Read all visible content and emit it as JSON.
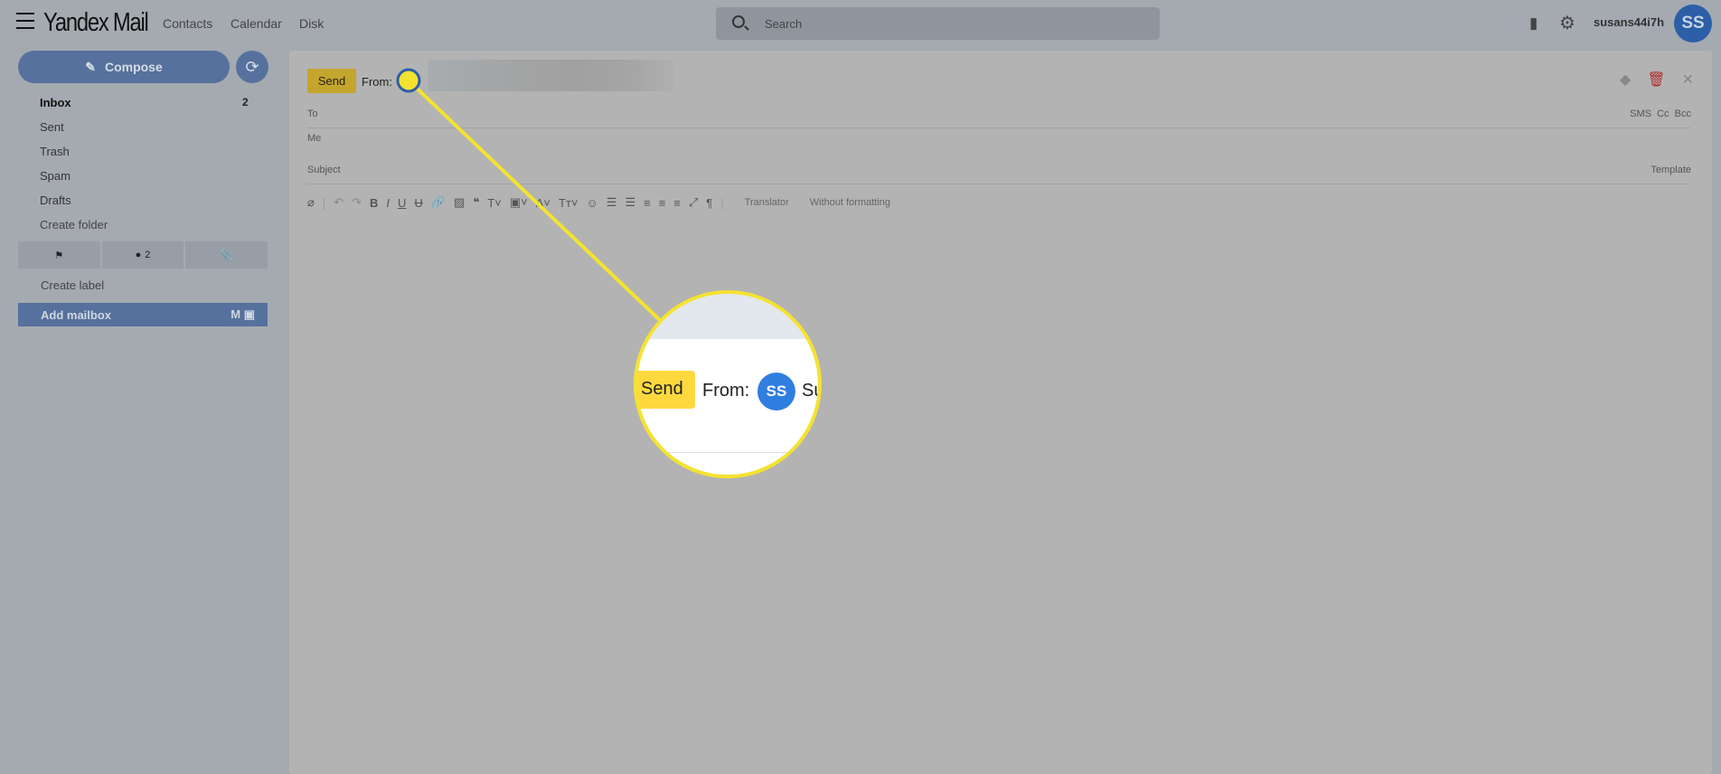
{
  "header": {
    "logo": "Yandex Mail",
    "nav": [
      "Contacts",
      "Calendar",
      "Disk"
    ],
    "search_placeholder": "Search",
    "username": "susans44i7h",
    "avatar_initials": "SS"
  },
  "sidebar": {
    "compose_label": "Compose",
    "folders": [
      {
        "label": "Inbox",
        "count": "2"
      },
      {
        "label": "Sent"
      },
      {
        "label": "Trash"
      },
      {
        "label": "Spam"
      },
      {
        "label": "Drafts"
      },
      {
        "label": "Create folder"
      }
    ],
    "unread_filter_count": "2",
    "create_label": "Create label",
    "add_mailbox": "Add mailbox"
  },
  "compose": {
    "send_label": "Send",
    "from_label": "From:",
    "to_label": "To",
    "me_label": "Me",
    "subject_label": "Subject",
    "sms": "SMS",
    "cc": "Cc",
    "bcc": "Bcc",
    "template": "Template",
    "translator": "Translator",
    "without_formatting": "Without formatting"
  },
  "magnifier": {
    "send_label": "Send",
    "from_label": "From:",
    "avatar_initials": "SS",
    "name_partial": "Su"
  },
  "colors": {
    "highlight": "#f4e231",
    "send": "#fdd83f",
    "avatar": "#2f7ee0",
    "accent": "#56719d"
  }
}
